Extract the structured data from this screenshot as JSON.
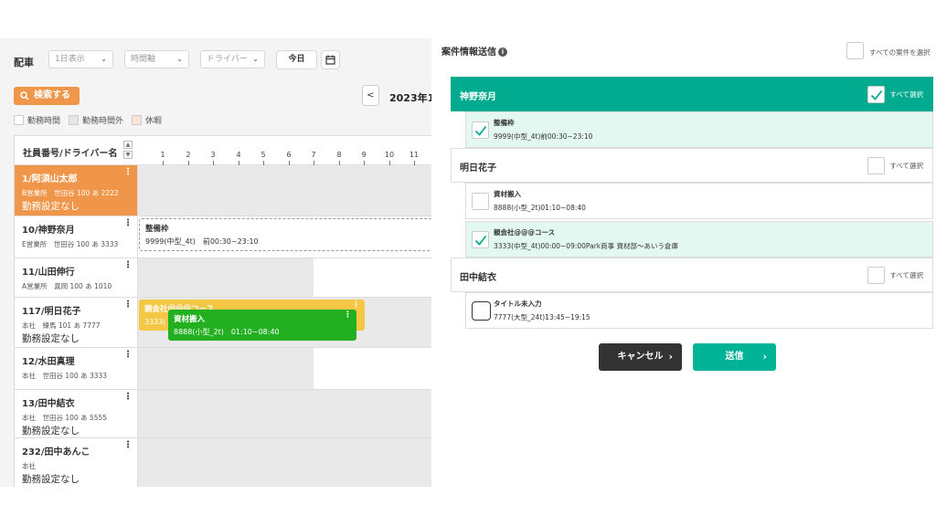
{
  "toolbar": {
    "title": "配車",
    "view_select": "1日表示",
    "axis_select": "時間軸",
    "driver_select": "ドライバー",
    "today_label": "今日",
    "search_label": "検索する",
    "prev_label": "<",
    "date_text": "2023年1"
  },
  "legend": [
    {
      "label": "勤務時間",
      "color": "#ffffff"
    },
    {
      "label": "勤務時間外",
      "color": "#e6e6e6"
    },
    {
      "label": "休暇",
      "color": "#fbe4d8"
    }
  ],
  "grid": {
    "header_title": "社員番号/ドライバー名",
    "hours": [
      "1",
      "2",
      "3",
      "4",
      "5",
      "6",
      "7",
      "8",
      "9",
      "10",
      "11"
    ],
    "rows": [
      {
        "name": "1/阿須山太郎",
        "sub": "B営業所　世田谷 100 あ 2222",
        "note": "勤務設定なし"
      },
      {
        "name": "10/神野奈月",
        "sub": "E営業所　世田谷 100 あ 3333",
        "note": ""
      },
      {
        "name": "11/山田伸行",
        "sub": "A営業所　真岡 100 あ 1010",
        "note": ""
      },
      {
        "name": "117/明日花子",
        "sub": "本社　練馬 101 あ 7777",
        "note": "勤務設定なし"
      },
      {
        "name": "12/水田真理",
        "sub": "本社　世田谷 100 あ 3333",
        "note": ""
      },
      {
        "name": "13/田中結衣",
        "sub": "本社　世田谷 100 あ 5555",
        "note": "勤務設定なし"
      },
      {
        "name": "232/田中あんこ",
        "sub": "本社",
        "note": "勤務設定なし"
      }
    ],
    "jobs": {
      "a_title": "整備枠",
      "a_sub": "9999(中型_4t)　前00:30~23:10",
      "b_title": "親会社＠＠＠コース",
      "b_sub": "3333(",
      "c_title": "資材搬入",
      "c_sub": "8888(小型_2t)　01:10~08:40"
    }
  },
  "panel": {
    "title": "案件情報送信",
    "select_all_cases": "すべての案件を選択",
    "select_all": "すべて選択",
    "groups": [
      {
        "name": "神野奈月",
        "checked": true,
        "items": [
          {
            "title": "整備枠",
            "sub": "9999(中型_4t)前00:30~23:10",
            "checked": true
          }
        ]
      },
      {
        "name": "明日花子",
        "checked": false,
        "items": [
          {
            "title": "資材搬入",
            "sub": "8888(小型_2t)01:10~08:40",
            "checked": false
          },
          {
            "title": "親会社@@@コース",
            "sub": "3333(中型_4t)00:00~09:00Park商事 資材部～あいう倉庫",
            "checked": true
          }
        ]
      },
      {
        "name": "田中結衣",
        "checked": false,
        "items": [
          {
            "title": "タイトル未入力",
            "sub": "7777(大型_24t)13:45~19:15",
            "checked": false
          }
        ]
      }
    ],
    "cancel_label": "キャンセル",
    "send_label": "送信",
    "colors": {
      "teal": "#00ab8f",
      "teal_light": "#e2f8f1",
      "orange": "#f0964a",
      "green": "#22b020",
      "yellow": "#f6c745"
    }
  }
}
